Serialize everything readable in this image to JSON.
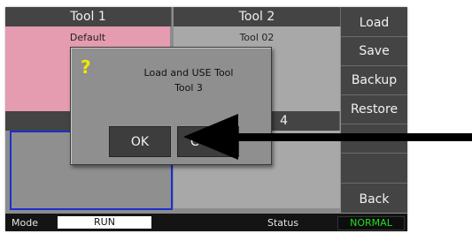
{
  "tiles": [
    {
      "header": "Tool 1",
      "name": "Default"
    },
    {
      "header": "Tool 2",
      "name": "Tool 02"
    },
    {
      "header": "",
      "name": ""
    },
    {
      "header": "4",
      "name": ""
    }
  ],
  "sidebar": {
    "buttons": [
      "Load",
      "Save",
      "Backup",
      "Restore",
      "",
      "",
      "Back"
    ]
  },
  "dialog": {
    "icon_glyph": "?",
    "icon_name": "question-icon",
    "line1": "Load and USE Tool",
    "line2": "Tool 3",
    "ok_label": "OK",
    "cancel_label": "C"
  },
  "statusbar": {
    "mode_label": "Mode",
    "mode_value": "RUN",
    "status_label": "Status",
    "status_value": "NORMAL"
  },
  "colors": {
    "selected_tile": "#e59bb0",
    "active_outline": "#1a2fd0",
    "status_ok": "#22dd22",
    "icon_yellow": "#f2e600"
  }
}
